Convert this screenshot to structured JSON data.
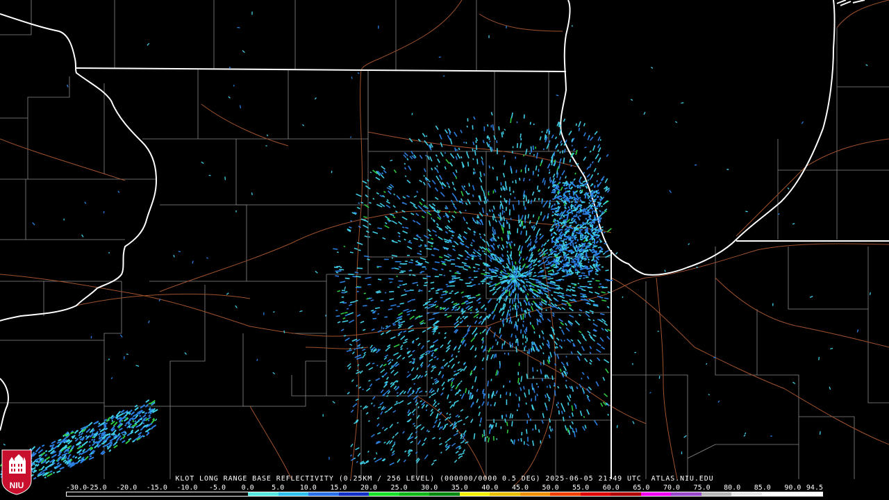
{
  "product_title": "KLOT LONG RANGE BASE REFLECTIVITY (0.25KM / 256 LEVEL) (000000/0000 0.5 DEG) 2025-06-05 21:49 UTC  ATLAS.NIU.EDU",
  "logo_text": "NIU",
  "colors": {
    "background": "#000000",
    "state_border": "#ffffff",
    "county_border": "#8a8a8a",
    "highway": "#a0522d",
    "echo_light": "#3fd0e8",
    "echo_medium": "#2a7fe0",
    "echo_strong": "#2ecc40",
    "logo_red": "#c8102e"
  },
  "color_scale": {
    "labels": [
      "-30.0",
      "-25.0",
      "-20.0",
      "-15.0",
      "-10.0",
      "-5.0",
      "0.0",
      "5.0",
      "10.0",
      "15.0",
      "20.0",
      "25.0",
      "30.0",
      "35.0",
      "40.0",
      "45.0",
      "50.0",
      "55.0",
      "60.0",
      "65.0",
      "70.0",
      "75.0",
      "80.0",
      "85.0",
      "90.0",
      "94.5"
    ],
    "colors": [
      "#000000",
      "#000000",
      "#000000",
      "#000000",
      "#000000",
      "#000000",
      "#55e8e0",
      "#2ec0f0",
      "#2a70e8",
      "#1030c8",
      "#18e028",
      "#0fb818",
      "#078a10",
      "#f0f000",
      "#e8c000",
      "#f09000",
      "#f04000",
      "#e00000",
      "#b00000",
      "#f000f0",
      "#9848c8",
      "#b8b8b8",
      "#e8e8e8",
      "#ffffff",
      "#ffffff"
    ]
  }
}
